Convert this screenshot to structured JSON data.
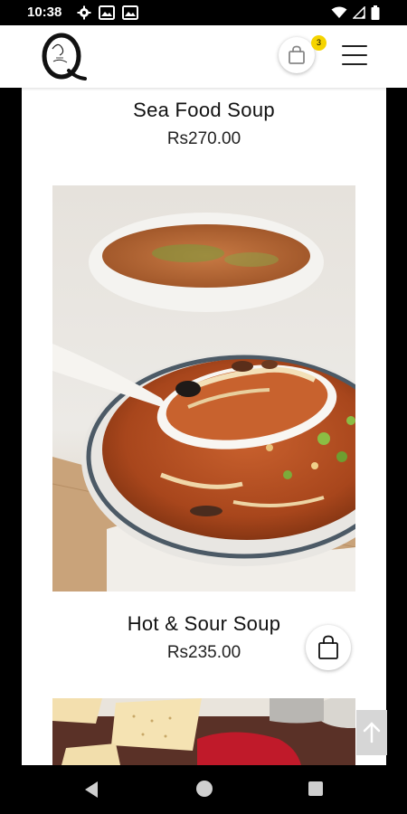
{
  "status_bar": {
    "time": "10:38"
  },
  "header": {
    "cart_count": "3",
    "brand_color": "#f5d400"
  },
  "products": [
    {
      "name": "Sea Food Soup",
      "price": "Rs270.00"
    },
    {
      "name": "Hot & Sour Soup",
      "price": "Rs235.00"
    }
  ],
  "icons": {
    "status": [
      "settings-icon",
      "gallery-icon",
      "gallery-icon",
      "wifi-icon",
      "signal-icon",
      "battery-icon"
    ],
    "header": [
      "logo",
      "shopping-bag-icon",
      "hamburger-menu-icon"
    ],
    "product": [
      "shopping-bag-icon"
    ],
    "float": [
      "arrow-up-icon"
    ],
    "nav": [
      "back-icon",
      "home-icon",
      "recents-icon"
    ]
  }
}
